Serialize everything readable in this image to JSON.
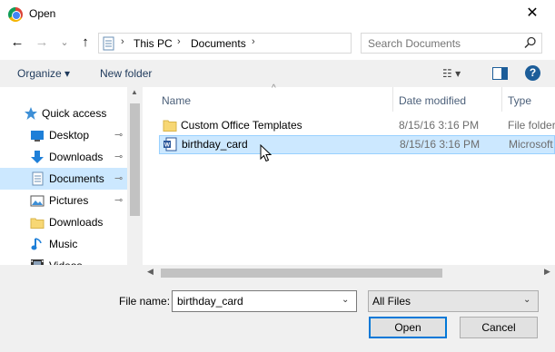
{
  "window": {
    "title": "Open",
    "close_glyph": "✕"
  },
  "nav": {
    "back": "←",
    "forward": "→",
    "history": "⌄",
    "up": "↑"
  },
  "address": {
    "segments": [
      "This PC",
      "Documents"
    ],
    "chevron": "›",
    "dropdown": "⌄",
    "refresh": "↻"
  },
  "search": {
    "placeholder": "Search Documents"
  },
  "toolbar": {
    "organize": "Organize ▾",
    "new_folder": "New folder",
    "view_glyph": "☷ ▾",
    "help": "?"
  },
  "sidebar": {
    "items": [
      {
        "label": "Quick access",
        "icon": "star-icon",
        "pinned": false
      },
      {
        "label": "Desktop",
        "icon": "desktop-icon",
        "pinned": true
      },
      {
        "label": "Downloads",
        "icon": "download-icon",
        "pinned": true
      },
      {
        "label": "Documents",
        "icon": "document-icon",
        "pinned": true,
        "selected": true
      },
      {
        "label": "Pictures",
        "icon": "pictures-icon",
        "pinned": true
      },
      {
        "label": "Downloads",
        "icon": "folder-icon",
        "pinned": false
      },
      {
        "label": "Music",
        "icon": "music-icon",
        "pinned": false
      },
      {
        "label": "Videos",
        "icon": "videos-icon",
        "pinned": false
      }
    ],
    "pin_glyph": "📌"
  },
  "columns": {
    "name": "Name",
    "date": "Date modified",
    "type": "Type",
    "sort_glyph": "^"
  },
  "files": [
    {
      "name": "Custom Office Templates",
      "date": "8/15/16 3:16 PM",
      "type": "File folder",
      "icon": "folder-icon"
    },
    {
      "name": "birthday_card",
      "date": "8/15/16 3:16 PM",
      "type": "Microsoft Word Document",
      "icon": "word-doc-icon",
      "selected": true
    }
  ],
  "footer": {
    "filename_label": "File name:",
    "filename_value": "birthday_card",
    "filetype_value": "All Files",
    "open_label": "Open",
    "cancel_label": "Cancel"
  },
  "colors": {
    "selection": "#cce8ff",
    "accent": "#0078d7",
    "link_text": "#1e395b"
  }
}
